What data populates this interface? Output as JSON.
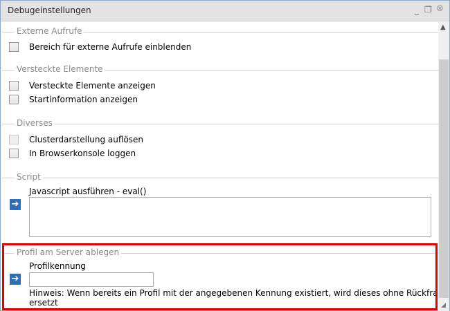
{
  "window": {
    "title": "Debugeinstellungen",
    "minimize_icon": "minimize-icon",
    "restore_icon": "restore-icon",
    "close_icon": "close-icon"
  },
  "groups": {
    "external": {
      "label": "Externe Aufrufe",
      "items": [
        "Bereich für externe Aufrufe einblenden"
      ]
    },
    "hidden": {
      "label": "Versteckte Elemente",
      "items": [
        "Versteckte Elemente anzeigen",
        "Startinformation anzeigen"
      ]
    },
    "misc": {
      "label": "Diverses",
      "items": [
        "Clusterdarstellung auflösen",
        "In Browserkonsole loggen"
      ]
    },
    "script": {
      "label": "Script",
      "field_label": "Javascript ausführen - eval()",
      "value": ""
    },
    "profile": {
      "label": "Profil am Server ablegen",
      "field_label": "Profilkennung",
      "value": "",
      "hint": "Hinweis: Wenn bereits ein Profil mit der angegebenen Kennung existiert, wird dieses ohne Rückfrage ersetzt"
    }
  },
  "highlight_color": "#e00000"
}
